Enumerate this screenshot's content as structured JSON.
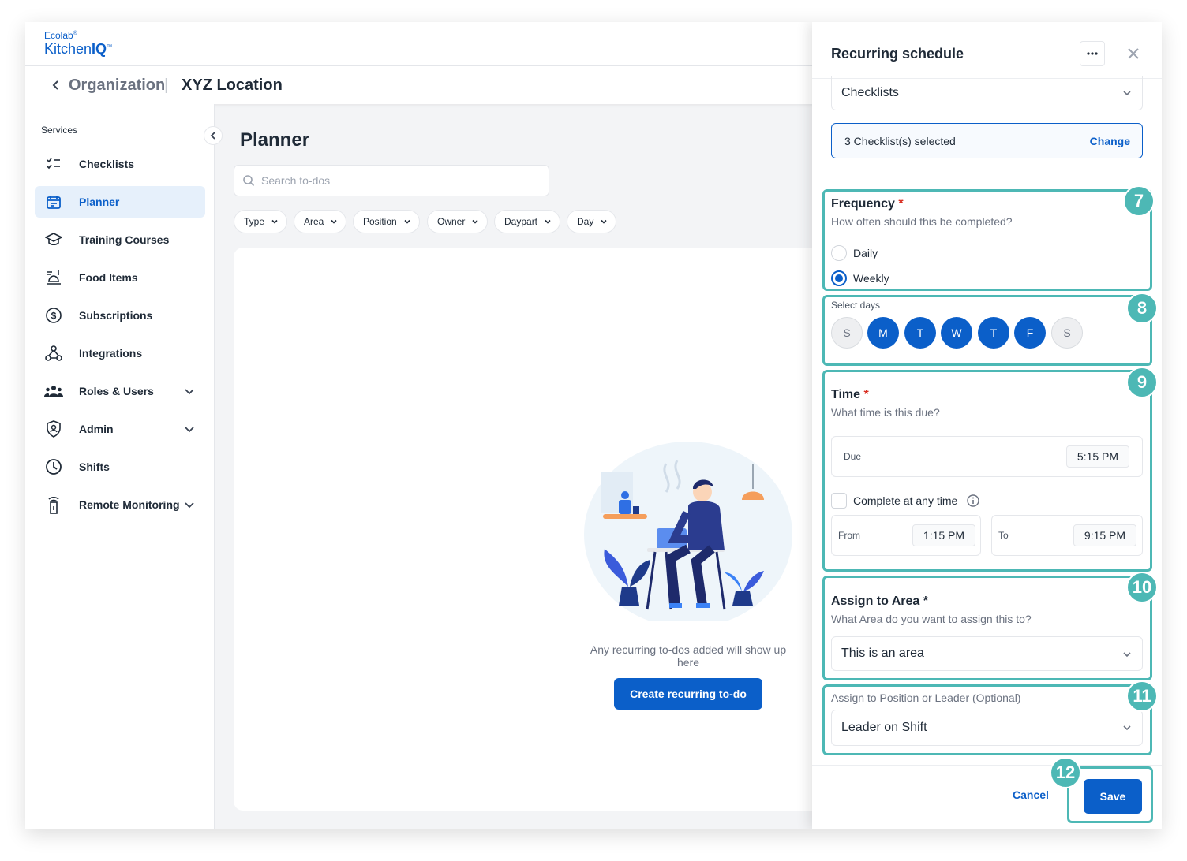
{
  "logo": {
    "brand": "Ecolab",
    "product_prefix": "Kitchen",
    "product_suffix": "IQ"
  },
  "breadcrumb": {
    "org": "Organization",
    "separator": "|",
    "location": "XYZ Location"
  },
  "sidebar": {
    "section_title": "Services",
    "items": [
      {
        "label": "Checklists",
        "icon": "checklist-icon"
      },
      {
        "label": "Planner",
        "icon": "calendar-icon",
        "active": true
      },
      {
        "label": "Training Courses",
        "icon": "graduation-cap-icon"
      },
      {
        "label": "Food Items",
        "icon": "food-tray-icon"
      },
      {
        "label": "Subscriptions",
        "icon": "dollar-circle-icon"
      },
      {
        "label": "Integrations",
        "icon": "integrations-icon"
      },
      {
        "label": "Roles & Users",
        "icon": "users-icon",
        "expandable": true
      },
      {
        "label": "Admin",
        "icon": "shield-icon",
        "expandable": true
      },
      {
        "label": "Shifts",
        "icon": "clock-icon"
      },
      {
        "label": "Remote Monitoring",
        "icon": "sensor-icon",
        "expandable": true
      }
    ]
  },
  "main": {
    "title": "Planner",
    "search_placeholder": "Search to-dos",
    "filters": [
      "Type",
      "Area",
      "Position",
      "Owner",
      "Daypart",
      "Day"
    ],
    "empty_text": "Any recurring to-dos added will show up here",
    "create_button": "Create recurring to-do"
  },
  "drawer": {
    "title": "Recurring schedule",
    "type_select": "Checklists",
    "checklists_selected": "3 Checklist(s) selected",
    "change_label": "Change",
    "frequency": {
      "title": "Frequency",
      "required": "*",
      "subtitle": "How often should this be completed?",
      "options": [
        "Daily",
        "Weekly"
      ],
      "selected": "Weekly"
    },
    "days": {
      "label": "Select days",
      "items": [
        {
          "label": "S",
          "on": false
        },
        {
          "label": "M",
          "on": true
        },
        {
          "label": "T",
          "on": true
        },
        {
          "label": "W",
          "on": true
        },
        {
          "label": "T",
          "on": true
        },
        {
          "label": "F",
          "on": true
        },
        {
          "label": "S",
          "on": false
        }
      ]
    },
    "time": {
      "title": "Time",
      "required": "*",
      "subtitle": "What time is this due?",
      "due_label": "Due",
      "due_value": "5:15 PM",
      "any_time_label": "Complete at any time",
      "from_label": "From",
      "from_value": "1:15 PM",
      "to_label": "To",
      "to_value": "9:15 PM"
    },
    "area": {
      "title": "Assign to Area *",
      "subtitle": "What Area do you want to assign this to?",
      "value": "This is an area"
    },
    "position": {
      "label": "Assign to Position or Leader (Optional)",
      "value": "Leader on Shift"
    },
    "cancel_label": "Cancel",
    "save_label": "Save"
  },
  "badges": [
    "7",
    "8",
    "9",
    "10",
    "11",
    "12"
  ],
  "colors": {
    "primary": "#0b5fc9",
    "highlight": "#4db8b5",
    "required": "#d92d20"
  }
}
